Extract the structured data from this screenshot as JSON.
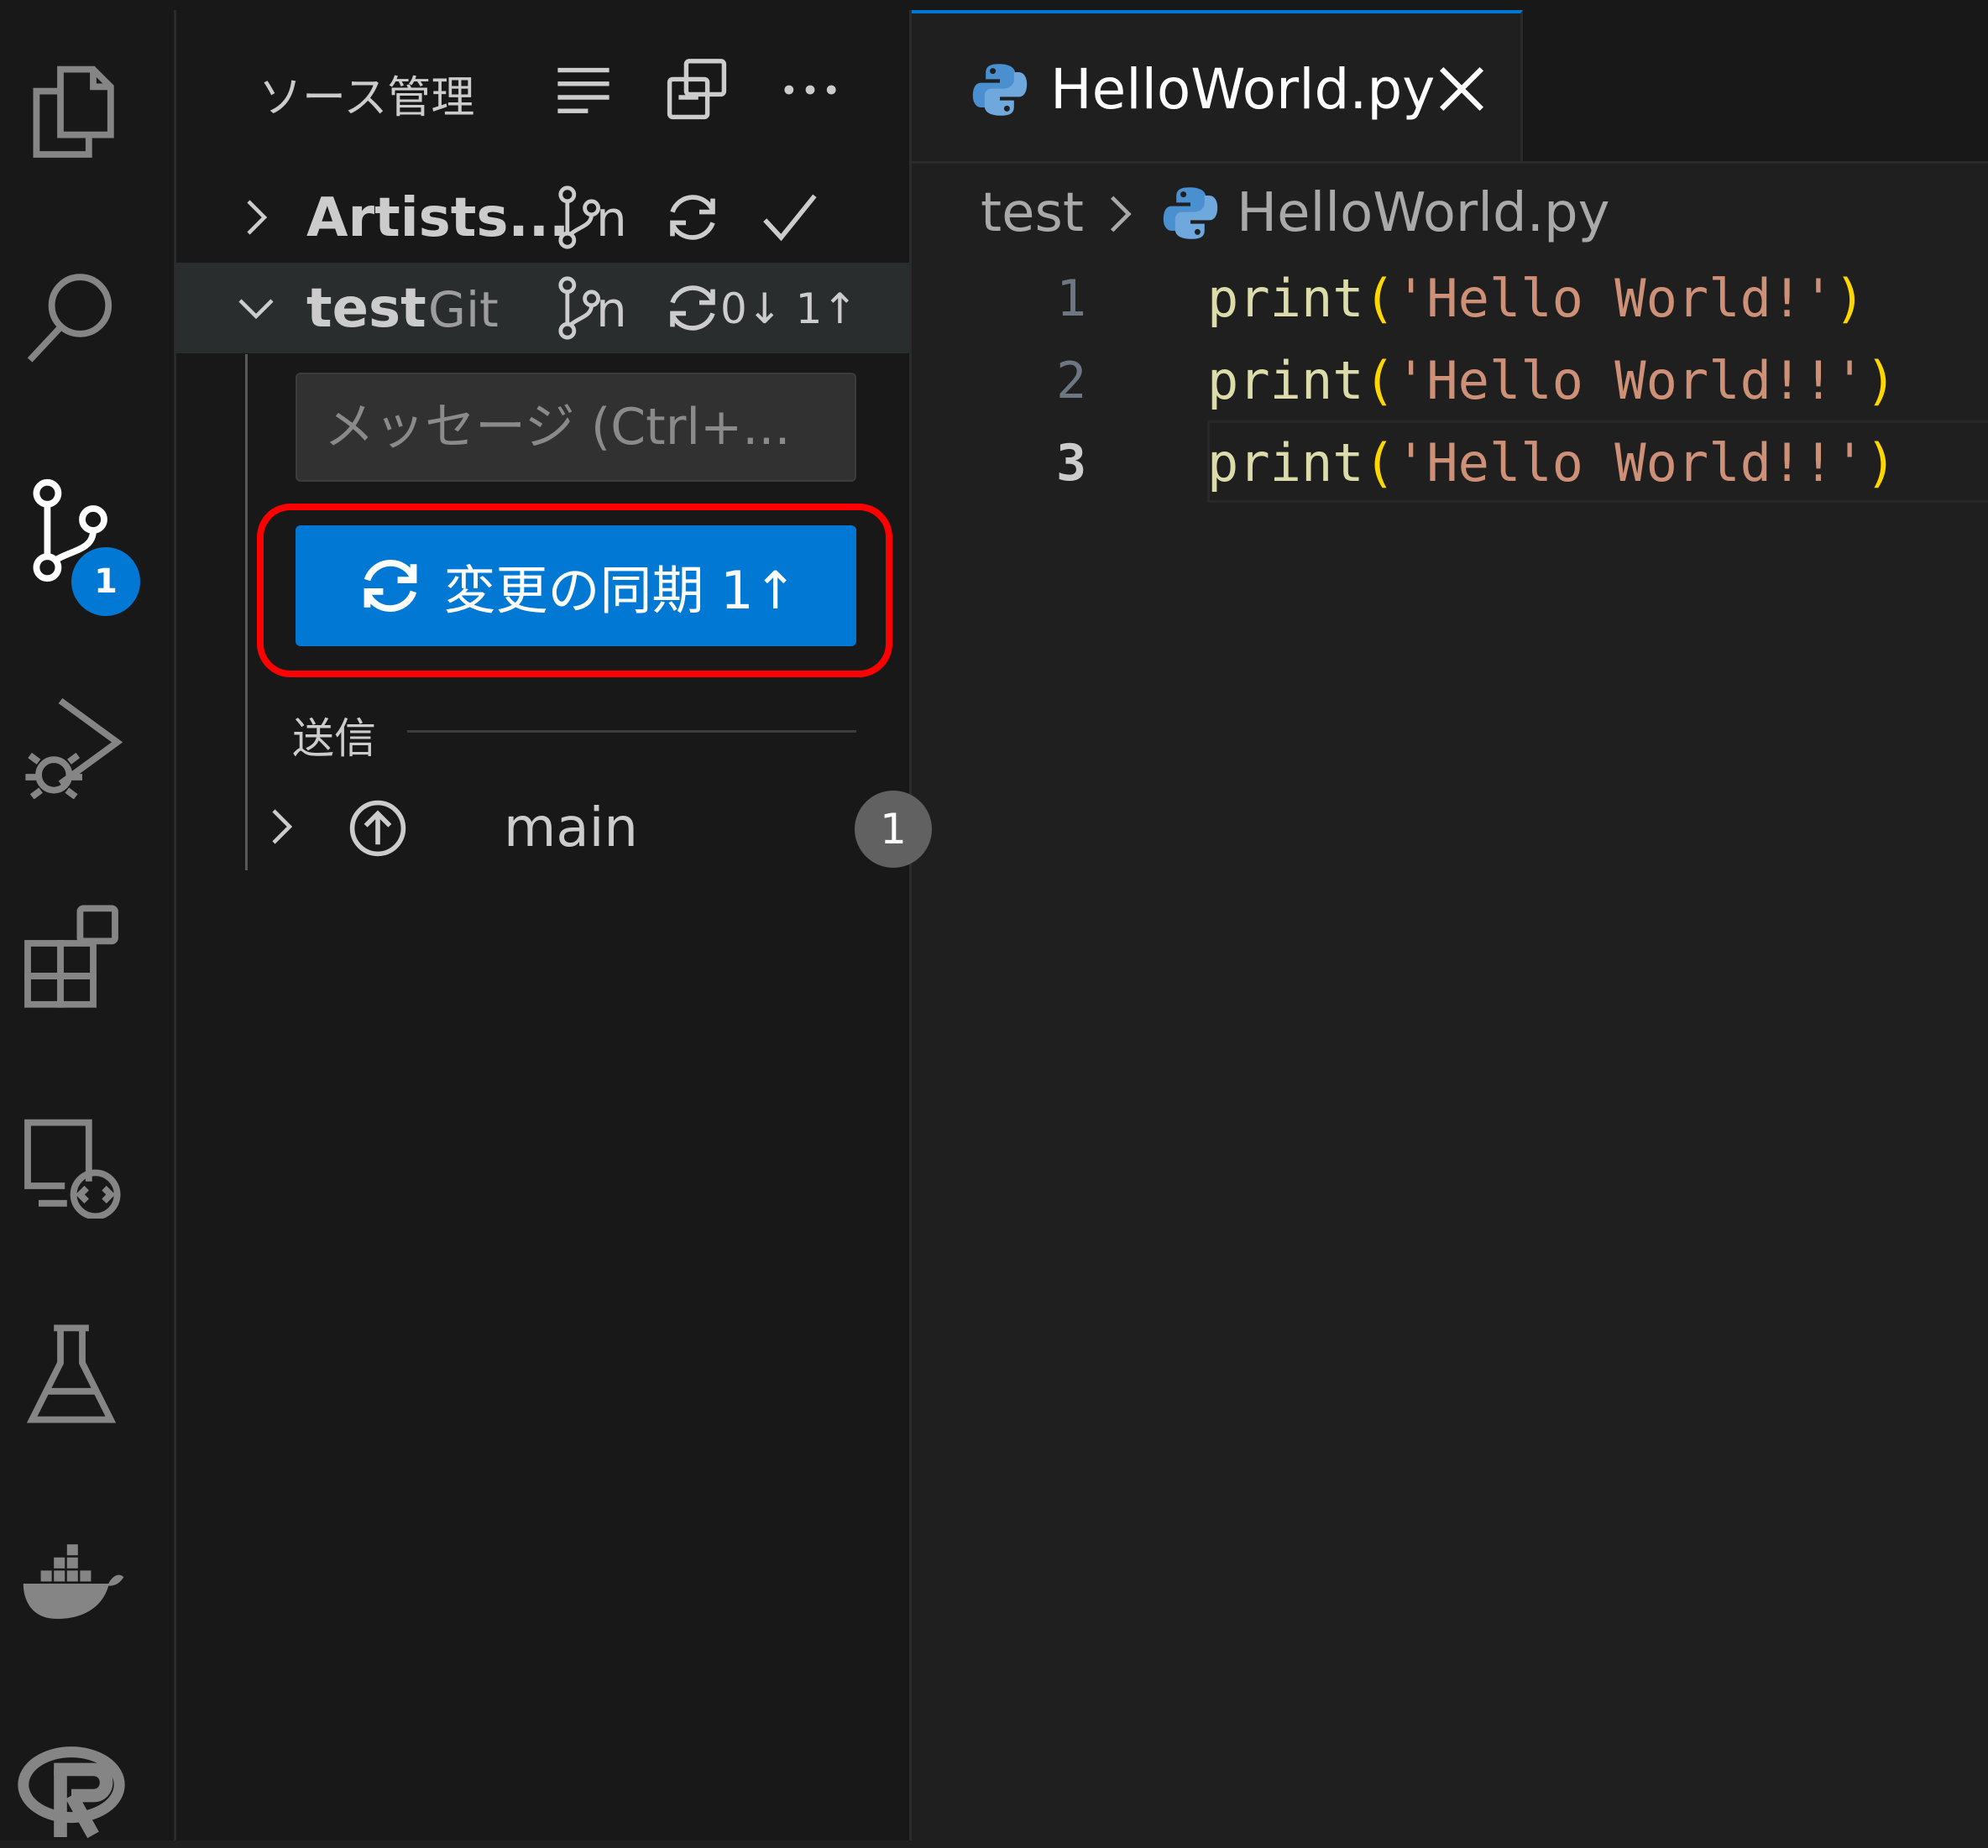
{
  "sidebar": {
    "title": "ソース管理",
    "repos": [
      {
        "name": "Artists...",
        "kind": "",
        "branch_abbrev": "n",
        "counts": ""
      },
      {
        "name": "test",
        "kind": "Git",
        "branch_abbrev": "n",
        "counts": "0↓ 1↑"
      }
    ],
    "message_placeholder": "メッセージ (Ctrl+...",
    "sync_button_label": "変更の同期 1↑",
    "section_label": "送信",
    "branch": {
      "name": "main",
      "count": "1"
    }
  },
  "activity": {
    "scm_badge": "1"
  },
  "editor": {
    "tab_name": "HelloWorld.py",
    "breadcrumb": [
      "test",
      "HelloWorld.py"
    ],
    "lines": [
      {
        "num": "1",
        "fn": "print",
        "open": "(",
        "str": "'Hello World!'",
        "close": ")"
      },
      {
        "num": "2",
        "fn": "print",
        "open": "(",
        "str": "'Hello World!!'",
        "close": ")"
      },
      {
        "num": "3",
        "fn": "print",
        "open": "(",
        "str": "'Hello World!!'",
        "close": ")"
      }
    ]
  },
  "colors": {
    "accent": "#0078d4",
    "highlight": "#ff0000",
    "background": "#1f1f1f",
    "sidebar": "#181818"
  }
}
